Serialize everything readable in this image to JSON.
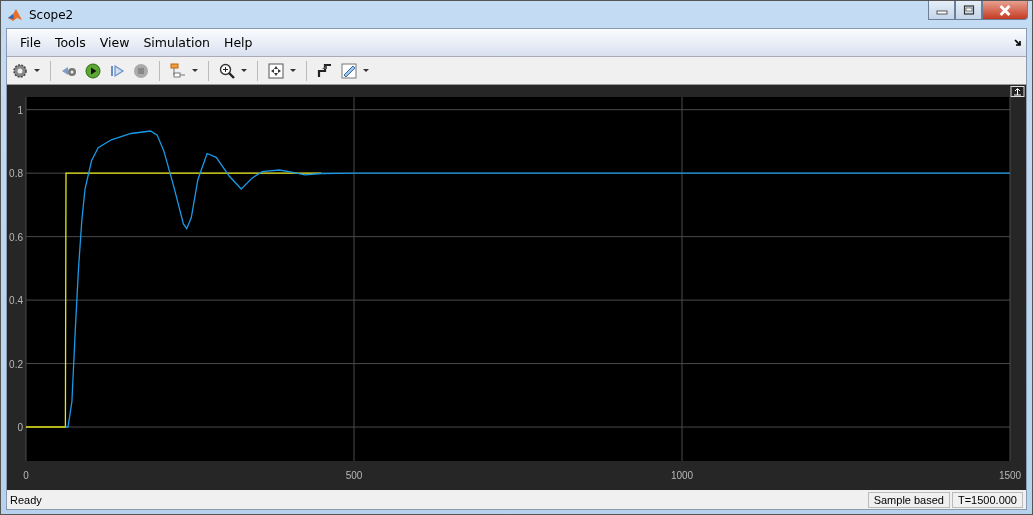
{
  "window": {
    "title": "Scope2"
  },
  "menu": [
    "File",
    "Tools",
    "View",
    "Simulation",
    "Help"
  ],
  "scope": {
    "chart_data": {
      "type": "line",
      "x": [
        0,
        60,
        61,
        64,
        70,
        75,
        80,
        85,
        90,
        100,
        110,
        130,
        160,
        190,
        200,
        210,
        225,
        240,
        245,
        252,
        262,
        276,
        290,
        310,
        328,
        345,
        360,
        386,
        405,
        425,
        450,
        500,
        1000,
        1500
      ],
      "series": [
        {
          "color": "#e6e619",
          "values": [
            0,
            0,
            0.8,
            0.8,
            0.8,
            0.8,
            0.8,
            0.8,
            0.8,
            0.8,
            0.8,
            0.8,
            0.8,
            0.8,
            0.8,
            0.8,
            0.8,
            0.8,
            0.8,
            0.8,
            0.8,
            0.8,
            0.8,
            0.8,
            0.8,
            0.8,
            0.8,
            0.8,
            0.8,
            0.8,
            0.8,
            null,
            null,
            null
          ]
        },
        {
          "color": "#1a9ae6",
          "values": [
            null,
            0,
            0,
            0,
            0.08,
            0.3,
            0.5,
            0.65,
            0.75,
            0.84,
            0.88,
            0.905,
            0.925,
            0.933,
            0.92,
            0.87,
            0.76,
            0.64,
            0.625,
            0.66,
            0.78,
            0.862,
            0.85,
            0.79,
            0.75,
            0.785,
            0.805,
            0.81,
            0.803,
            0.795,
            0.799,
            0.8,
            0.8,
            0.8
          ]
        }
      ],
      "xlim": [
        0,
        1500
      ],
      "ylim": [
        -0.107,
        1.04
      ],
      "xticks": [
        0,
        500,
        1000,
        1500
      ],
      "yticks": [
        0,
        0.2,
        0.4,
        0.6,
        0.8,
        1
      ],
      "grid": true
    }
  },
  "status_bar": {
    "message": "Ready",
    "sections": [
      "Sample based",
      "T=1500.000"
    ]
  }
}
